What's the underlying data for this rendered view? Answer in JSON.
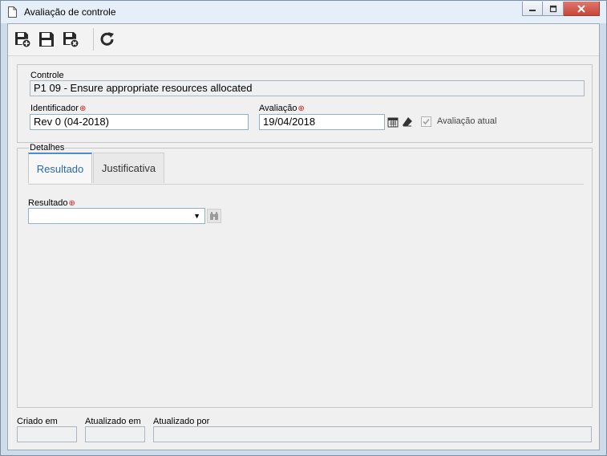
{
  "window": {
    "title": "Avaliação de controle"
  },
  "toolbar": {
    "buttons": [
      {
        "icon": "save-new-icon"
      },
      {
        "icon": "save-icon"
      },
      {
        "icon": "save-close-icon"
      },
      {
        "icon": "refresh-icon"
      }
    ]
  },
  "form": {
    "controle_label": "Controle",
    "controle_value": "P1 09 - Ensure appropriate resources allocated",
    "identificador_label": "Identificador",
    "identificador_value": "Rev 0 (04-2018)",
    "avaliacao_label": "Avaliação",
    "avaliacao_value": "19/04/2018",
    "avaliacao_atual_label": "Avaliação atual",
    "avaliacao_atual_checked": true
  },
  "details": {
    "group_label": "Detalhes",
    "tabs": [
      {
        "label": "Resultado",
        "active": true
      },
      {
        "label": "Justificativa",
        "active": false
      }
    ],
    "resultado_label": "Resultado",
    "resultado_value": ""
  },
  "footer": {
    "criado_em_label": "Criado em",
    "atualizado_em_label": "Atualizado em",
    "atualizado_por_label": "Atualizado por"
  },
  "colors": {
    "required": "#d42020",
    "tab_accent": "#4d8dcf",
    "field_border": "#8fb0cf"
  }
}
